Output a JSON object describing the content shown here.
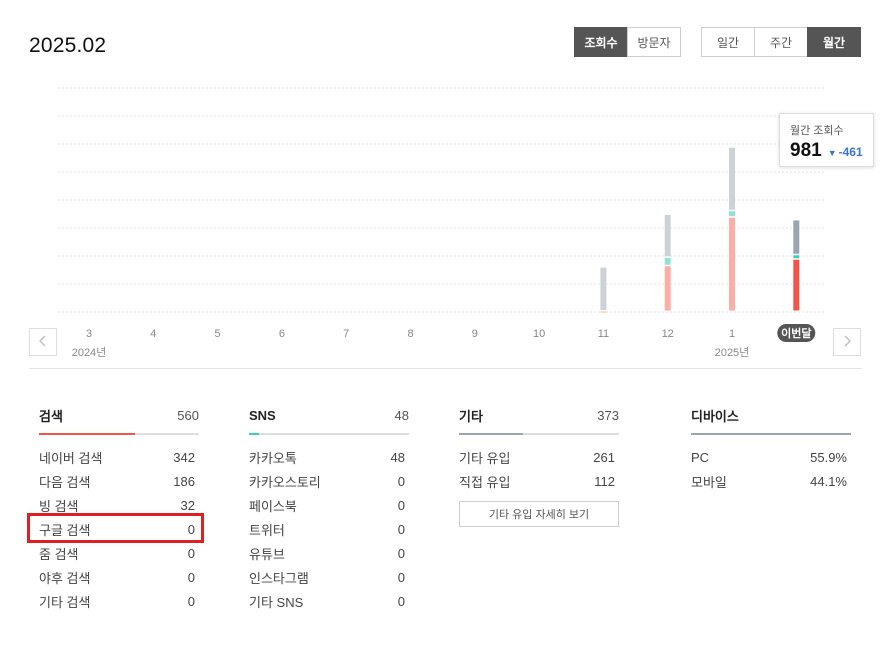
{
  "header": {
    "period": "2025.02"
  },
  "metric_toggle": [
    {
      "label": "조회수",
      "active": true
    },
    {
      "label": "방문자",
      "active": false
    }
  ],
  "range_toggle": [
    {
      "label": "일간",
      "active": false
    },
    {
      "label": "주간",
      "active": false
    },
    {
      "label": "월간",
      "active": true
    }
  ],
  "icons": {
    "prev": "chevron-left-icon",
    "next": "chevron-right-icon",
    "delta": "caret-down-icon"
  },
  "colors": {
    "active_button": "#555555",
    "search": "#f25449",
    "sns": "#3fcfb4",
    "etc": "#9aa5b1",
    "device": "#9aa5b1",
    "delta": "#3b73d9",
    "highlight": "#e02020",
    "current_pill": "#555555"
  },
  "chart_data": {
    "type": "bar",
    "stacked": true,
    "categories": [
      "3",
      "4",
      "5",
      "6",
      "7",
      "8",
      "9",
      "10",
      "11",
      "12",
      "1",
      "이번달"
    ],
    "year_labels": [
      {
        "category": "3",
        "label": "2024년"
      },
      {
        "category": "1",
        "label": "2025년"
      }
    ],
    "current_category": "이번달",
    "series": [
      {
        "key": "search",
        "values": [
          0,
          0,
          0,
          0,
          0,
          0,
          0,
          0,
          5,
          490,
          1010,
          560
        ]
      },
      {
        "key": "sns",
        "values": [
          0,
          0,
          0,
          0,
          0,
          0,
          0,
          0,
          0,
          90,
          70,
          48
        ]
      },
      {
        "key": "etc",
        "values": [
          0,
          0,
          0,
          0,
          0,
          0,
          0,
          0,
          470,
          460,
          680,
          373
        ]
      }
    ],
    "ylim": [
      0,
      2400
    ],
    "grid": true,
    "legend": false
  },
  "tooltip": {
    "label": "월간 조회수",
    "value": "981",
    "delta": "-461"
  },
  "panels": {
    "search": {
      "title": "검색",
      "total": "560",
      "share": 0.6,
      "rows": [
        {
          "label": "네이버 검색",
          "value": "342"
        },
        {
          "label": "다음 검색",
          "value": "186"
        },
        {
          "label": "빙 검색",
          "value": "32"
        },
        {
          "label": "구글 검색",
          "value": "0"
        },
        {
          "label": "줌 검색",
          "value": "0"
        },
        {
          "label": "야후 검색",
          "value": "0"
        },
        {
          "label": "기타 검색",
          "value": "0"
        }
      ]
    },
    "sns": {
      "title": "SNS",
      "total": "48",
      "share": 0.06,
      "rows": [
        {
          "label": "카카오톡",
          "value": "48"
        },
        {
          "label": "카카오스토리",
          "value": "0"
        },
        {
          "label": "페이스북",
          "value": "0"
        },
        {
          "label": "트위터",
          "value": "0"
        },
        {
          "label": "유튜브",
          "value": "0"
        },
        {
          "label": "인스타그램",
          "value": "0"
        },
        {
          "label": "기타 SNS",
          "value": "0"
        }
      ]
    },
    "etc": {
      "title": "기타",
      "total": "373",
      "share": 0.4,
      "rows": [
        {
          "label": "기타 유입",
          "value": "261"
        },
        {
          "label": "직접 유입",
          "value": "112"
        }
      ],
      "detail_button": "기타 유입 자세히 보기"
    },
    "device": {
      "title": "디바이스",
      "share": 1.0,
      "rows": [
        {
          "label": "PC",
          "value": "55.9%"
        },
        {
          "label": "모바일",
          "value": "44.1%"
        }
      ]
    }
  }
}
